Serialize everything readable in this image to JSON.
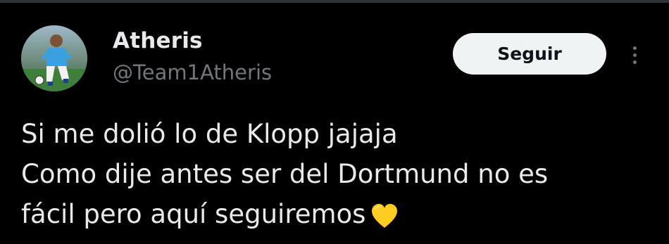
{
  "author": {
    "display_name": "Atheris",
    "handle": "@Team1Atheris"
  },
  "actions": {
    "follow_label": "Seguir"
  },
  "tweet": {
    "lines": [
      "Si me dolió lo de Klopp jajaja",
      "Como dije antes ser del Dortmund no es",
      "fácil pero aquí seguiremos"
    ],
    "emoji": "yellow-heart"
  },
  "colors": {
    "background": "#000000",
    "text_primary": "#e7e9ea",
    "text_secondary": "#71767b",
    "button_bg": "#eff3f4",
    "button_text": "#0f1419",
    "heart": "#ffcc21"
  },
  "icons": [
    "avatar-image",
    "more-options-icon",
    "yellow-heart-emoji"
  ]
}
